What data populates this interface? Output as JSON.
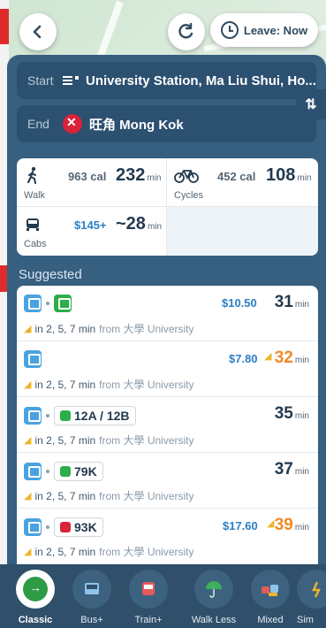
{
  "header": {
    "back_icon": "chevron-left-icon",
    "refresh_icon": "refresh-icon",
    "leave_label": "Leave: Now"
  },
  "trip": {
    "start_label": "Start",
    "start_value": "University Station, Ma Liu Shui, Ho...",
    "end_label": "End",
    "end_value": "旺角 Mong Kok"
  },
  "modes": [
    {
      "name": "Walk",
      "cal": "963 cal",
      "mins": "232",
      "unit": "min",
      "icon": "walk-icon"
    },
    {
      "name": "Cycles",
      "cal": "452 cal",
      "mins": "108",
      "unit": "min",
      "icon": "bicycle-icon"
    },
    {
      "name": "Cabs",
      "price": "$145+",
      "mins": "~28",
      "unit": "min",
      "icon": "taxi-icon"
    }
  ],
  "suggested_title": "Suggested",
  "routes": [
    {
      "price": "$10.50",
      "mins": "31",
      "unit": "min",
      "freq": "in 2, 5, 7 min",
      "from_text": "from 大學 University"
    },
    {
      "price": "$7.80",
      "mins": "32",
      "unit": "min",
      "freq": "in 2, 5, 7 min",
      "from_text": "from 大學 University"
    },
    {
      "bus": "12A / 12B",
      "mins": "35",
      "unit": "min",
      "freq": "in 2, 5, 7 min",
      "from_text": "from 大學 University"
    },
    {
      "bus": "79K",
      "mins": "37",
      "unit": "min",
      "freq": "in 2, 5, 7 min",
      "from_text": "from 大學 University"
    },
    {
      "bus": "93K",
      "price": "$17.60",
      "mins": "39",
      "unit": "min",
      "freq": "in 2, 5, 7 min",
      "from_text": "from 大學 University"
    }
  ],
  "tabs": [
    {
      "label": "Classic",
      "icon": "classic-icon"
    },
    {
      "label": "Bus+",
      "icon": "bus-icon"
    },
    {
      "label": "Train+",
      "icon": "train-icon"
    },
    {
      "label": "Walk Less",
      "icon": "umbrella-icon"
    },
    {
      "label": "Mixed",
      "icon": "mixed-icon"
    },
    {
      "label": "Sim",
      "icon": "simple-icon"
    }
  ],
  "colors": {
    "panel": "#365f80",
    "accent_blue": "#2c7fc4",
    "green": "#2cae4a",
    "orange": "#f08a24",
    "mtr_red": "#d9233a"
  }
}
